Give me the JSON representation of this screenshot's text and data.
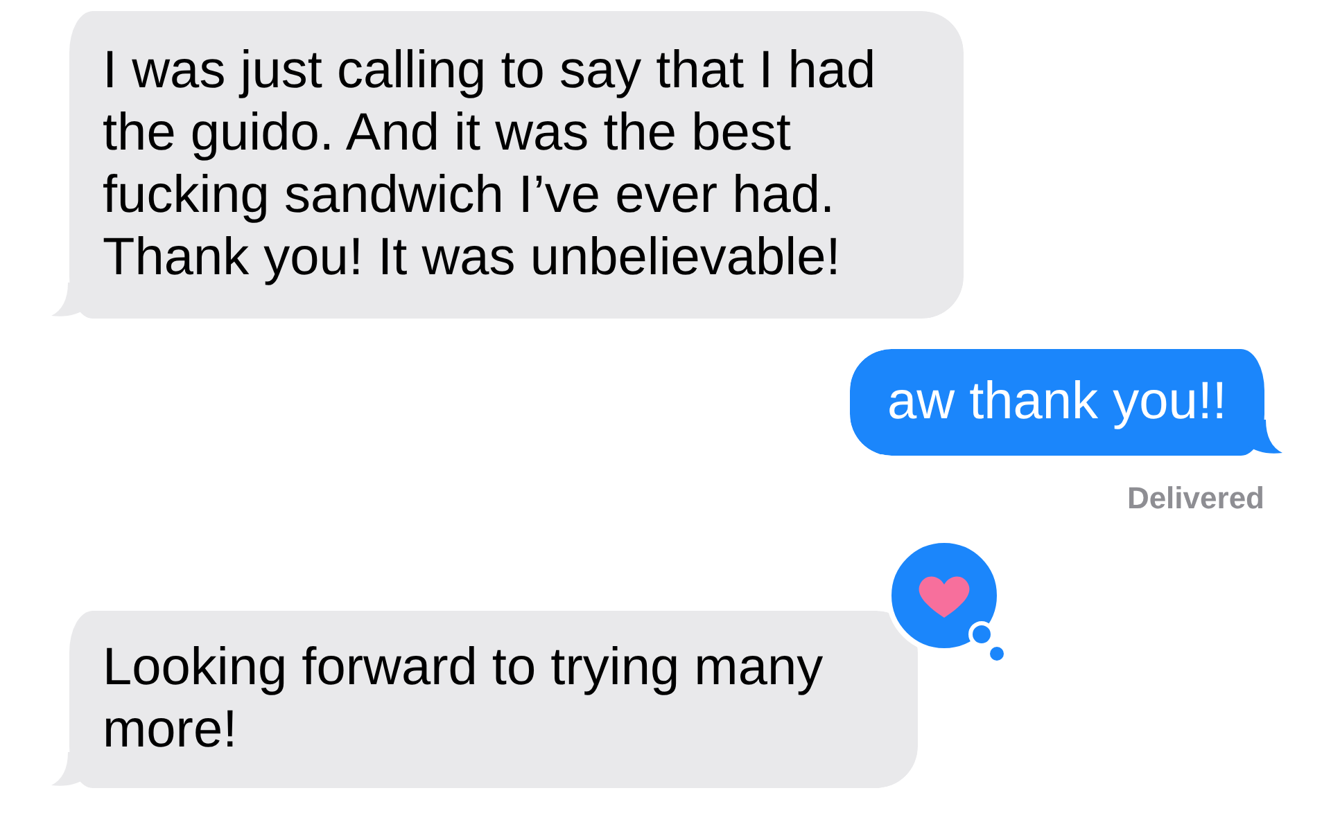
{
  "messages": [
    {
      "kind": "received",
      "text": "I was just calling to say that I had the guido. And it was the best fucking sandwich I’ve ever had. Thank you! It was unbelievable!"
    },
    {
      "kind": "sent",
      "text": "aw thank you!!",
      "status": "Delivered"
    },
    {
      "kind": "received",
      "text": "Looking forward to trying many more!",
      "reaction": {
        "kind": "heart"
      }
    }
  ]
}
